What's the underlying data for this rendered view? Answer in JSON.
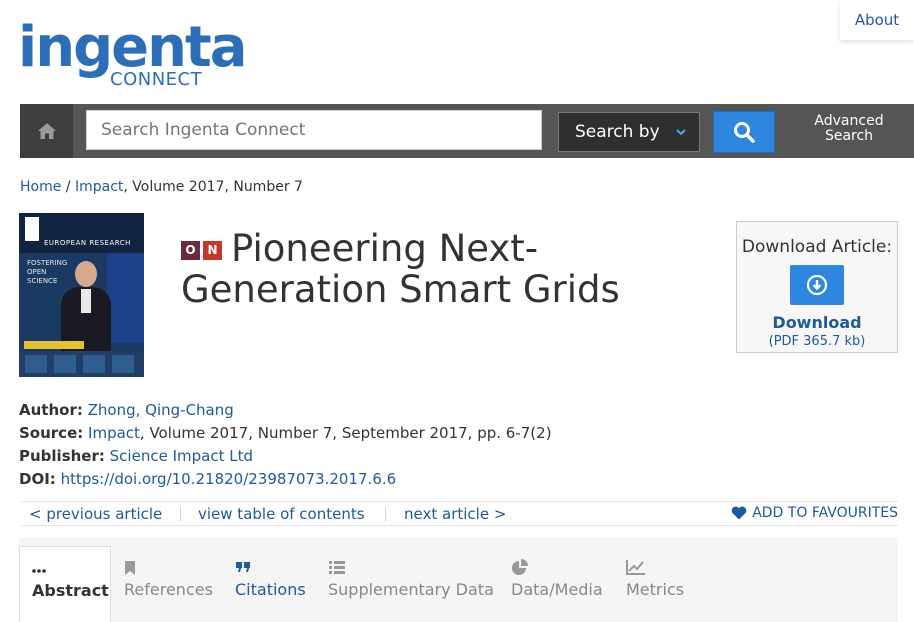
{
  "header": {
    "logo_word": "ingenta",
    "logo_sub": "CONNECT",
    "about_label": "About"
  },
  "search": {
    "placeholder": "Search Ingenta Connect",
    "search_by_label": "Search by",
    "advanced_label_line1": "Advanced",
    "advanced_label_line2": "Search"
  },
  "breadcrumb": {
    "home": "Home",
    "sep": " / ",
    "journal": "Impact",
    "rest": ", Volume 2017, Number 7"
  },
  "cover": {
    "caption": "EUROPEAN RESEARCH",
    "headline": "FOSTERING OPEN SCIENCE"
  },
  "article": {
    "access_o": "O",
    "access_n": "N",
    "title": "Pioneering Next-Generation Smart Grids"
  },
  "download": {
    "heading": "Download Article:",
    "label": "Download",
    "size": "(PDF 365.7 kb)"
  },
  "meta": {
    "author_label": "Author:",
    "author_value": "Zhong, Qing-Chang",
    "source_label": "Source:",
    "source_journal": "Impact",
    "source_rest": ", Volume 2017, Number 7, September 2017, pp. 6-7(2)",
    "publisher_label": "Publisher:",
    "publisher_value": "Science Impact Ltd",
    "doi_label": "DOI:",
    "doi_value": "https://doi.org/10.21820/23987073.2017.6.6"
  },
  "article_nav": {
    "previous": "< previous article",
    "toc": "view table of contents",
    "next": "next article >",
    "favourites": "ADD TO FAVOURITES"
  },
  "tabs": [
    {
      "label": "Abstract",
      "icon": "ellipsis-icon",
      "active": true
    },
    {
      "label": "References",
      "icon": "bookmark-icon",
      "active": false
    },
    {
      "label": "Citations",
      "icon": "quote-icon",
      "active": false
    },
    {
      "label": "Supplementary Data",
      "icon": "list-icon",
      "active": false
    },
    {
      "label": "Data/Media",
      "icon": "pie-chart-icon",
      "active": false
    },
    {
      "label": "Metrics",
      "icon": "line-chart-icon",
      "active": false
    }
  ],
  "colors": {
    "brand": "#2d6fb6",
    "link": "#1e5a9c",
    "button_blue": "#2e86de",
    "searchbar_bg": "#555555"
  }
}
